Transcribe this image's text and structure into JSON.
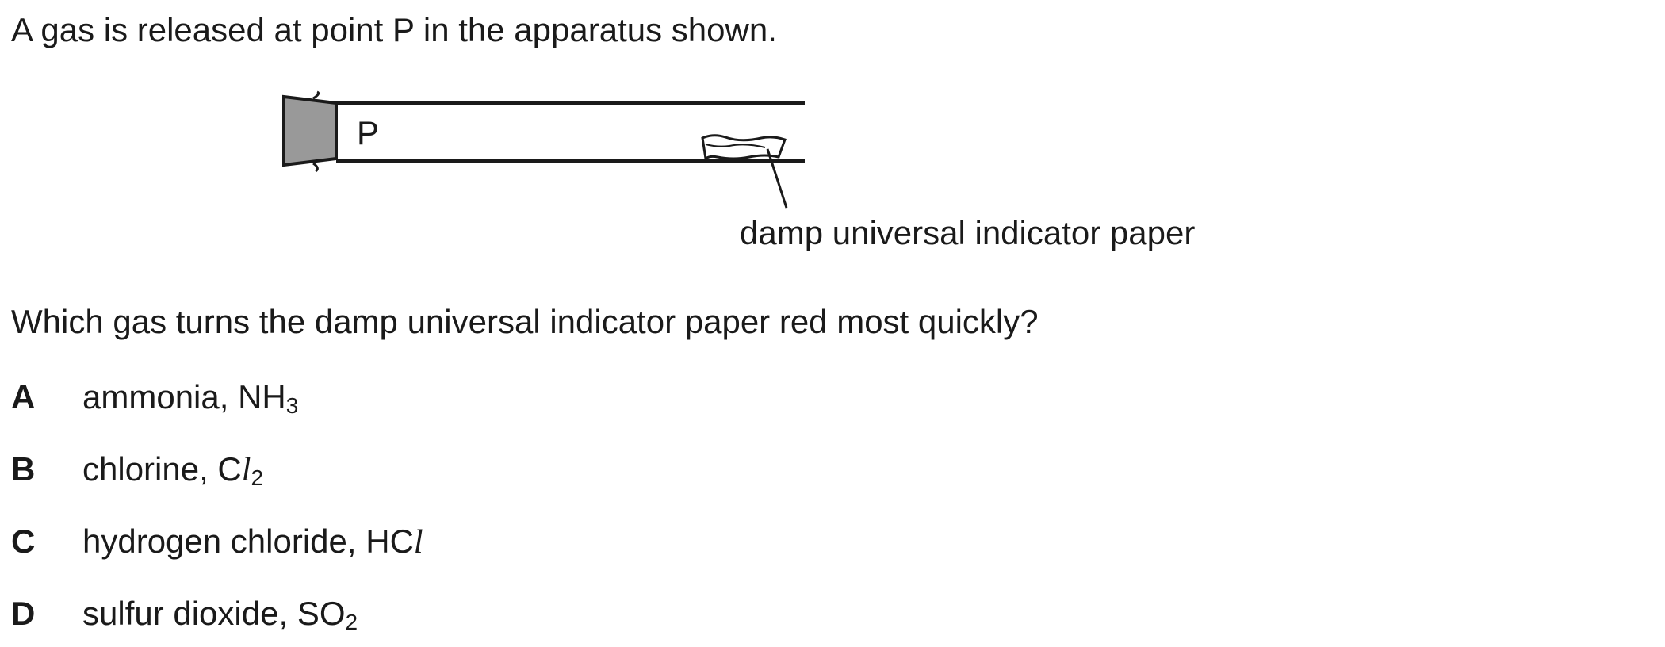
{
  "intro_text": "A gas is released at point P in the apparatus shown.",
  "diagram": {
    "point_label": "P",
    "paper_label": "damp universal indicator paper"
  },
  "question_text": "Which gas turns the damp universal indicator paper red most quickly?",
  "options": [
    {
      "letter": "A",
      "name": "ammonia, ",
      "formula_parts": [
        "NH",
        "3"
      ]
    },
    {
      "letter": "B",
      "name": "chlorine, ",
      "formula_parts": [
        "C",
        "l",
        "2"
      ]
    },
    {
      "letter": "C",
      "name": "hydrogen chloride, ",
      "formula_parts": [
        "HC",
        "l"
      ]
    },
    {
      "letter": "D",
      "name": "sulfur dioxide, ",
      "formula_parts": [
        "SO",
        "2"
      ]
    }
  ]
}
